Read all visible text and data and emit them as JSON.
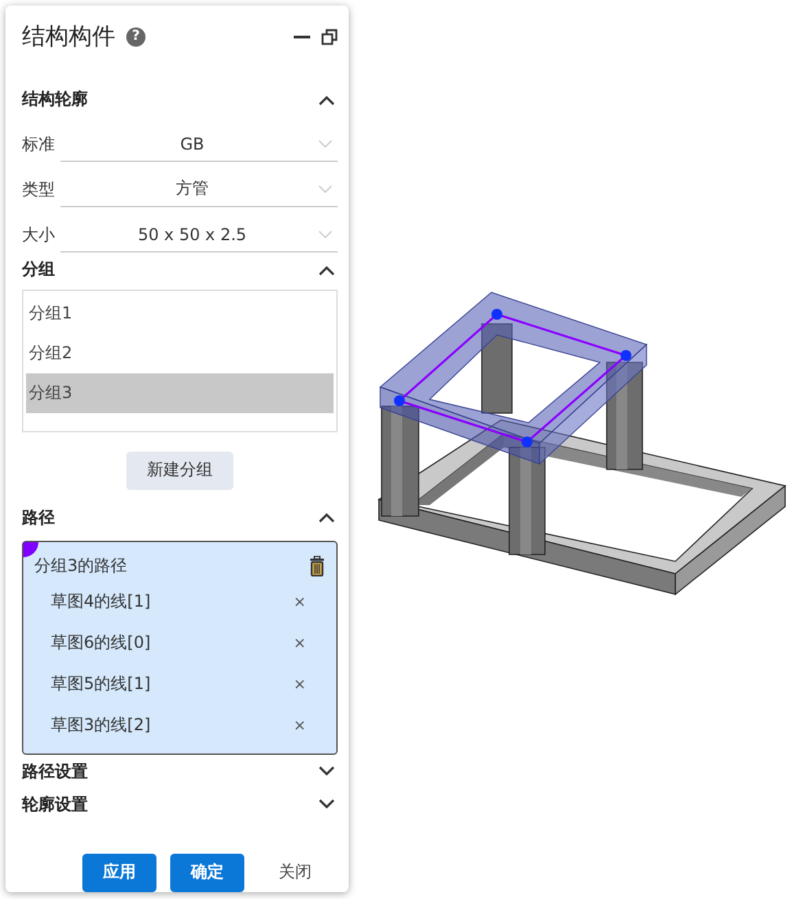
{
  "dialog": {
    "title": "结构构件",
    "help": "?"
  },
  "profile": {
    "title": "结构轮廓",
    "expanded": true,
    "fields": [
      {
        "label": "标准",
        "value": "GB"
      },
      {
        "label": "类型",
        "value": "方管"
      },
      {
        "label": "大小",
        "value": "50 x 50 x 2.5"
      }
    ]
  },
  "groups": {
    "title": "分组",
    "expanded": true,
    "items": [
      {
        "label": "分组1",
        "selected": false
      },
      {
        "label": "分组2",
        "selected": false
      },
      {
        "label": "分组3",
        "selected": true
      }
    ],
    "button": "新建分组"
  },
  "path": {
    "title": "路径",
    "expanded": true,
    "card": {
      "title": "分组3的路径",
      "color": "#8000ff",
      "items": [
        {
          "label": "草图4的线[1]",
          "remove": "×"
        },
        {
          "label": "草图6的线[0]",
          "remove": "×"
        },
        {
          "label": "草图5的线[1]",
          "remove": "×"
        },
        {
          "label": "草图3的线[2]",
          "remove": "×"
        }
      ]
    }
  },
  "settings": [
    {
      "title": "路径设置",
      "expanded": false
    },
    {
      "title": "轮廓设置",
      "expanded": false
    }
  ],
  "buttons": [
    {
      "label": "应用",
      "kind": "primary"
    },
    {
      "label": "确定",
      "kind": "primary"
    },
    {
      "label": "关闭",
      "kind": "text"
    }
  ]
}
